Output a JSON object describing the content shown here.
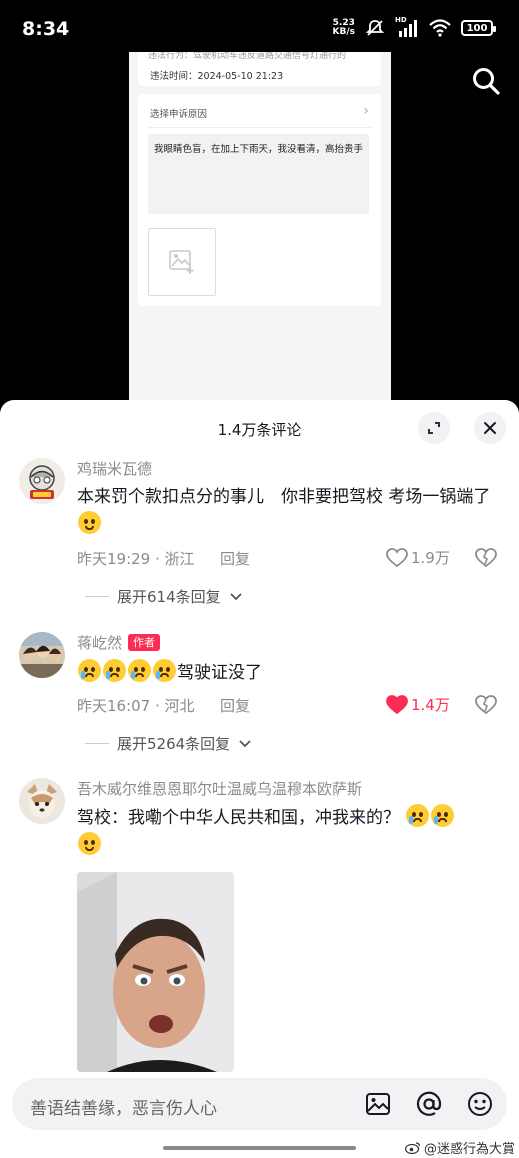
{
  "status_bar": {
    "time": "8:34",
    "net_speed_value": "5.23",
    "net_speed_unit": "KB/s",
    "hd_label": "HD",
    "battery": "100"
  },
  "video_screenshot": {
    "cutoff_line": "违法行为：驾驶机动车违反道路交通信号灯通行的",
    "violation_time": "违法时间：2024-05-10 21:23",
    "reason_title": "选择申诉原因",
    "reason_text": "我眼睛色盲，在加上下雨天，我没看清，高抬贵手"
  },
  "sheet": {
    "title": "1.4万条评论"
  },
  "comments": [
    {
      "user": "鸡瑞米瓦德",
      "text": "本来罚个款扣点分的事儿　你非要把驾校 考场一锅端了",
      "time_location": "昨天19:29 · 浙江",
      "reply_label": "回复",
      "likes": "1.9万",
      "expand_label": "展开614条回复"
    },
    {
      "user": "蒋屹然",
      "badge": "作者",
      "text": "驾驶证没了",
      "time_location": "昨天16:07 · 河北",
      "reply_label": "回复",
      "likes": "1.4万",
      "expand_label": "展开5264条回复"
    },
    {
      "user": "吾木威尔维恩恩耶尔吐温威乌温穆本欧萨斯",
      "text": "驾校：我嘞个中华人民共和国，冲我来的？"
    }
  ],
  "input_bar": {
    "placeholder": "善语结善缘，恶言伤人心"
  },
  "watermark": "@迷惑行為大賞",
  "colors": {
    "accent": "#fe2c55",
    "text_primary": "#161823",
    "text_secondary": "#8a8b91"
  }
}
